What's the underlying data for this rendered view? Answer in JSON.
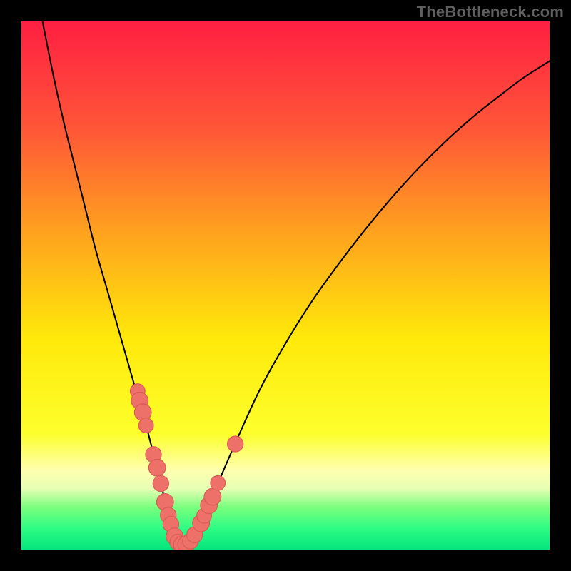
{
  "watermark": "TheBottleneck.com",
  "colors": {
    "frame": "#000000",
    "curve": "#000000",
    "marker_fill": "#ed7069",
    "marker_stroke": "#d85a52",
    "gradient_stops": [
      {
        "offset": 0.0,
        "color": "#ff1f42"
      },
      {
        "offset": 0.2,
        "color": "#ff5538"
      },
      {
        "offset": 0.4,
        "color": "#ffa21e"
      },
      {
        "offset": 0.6,
        "color": "#ffe90a"
      },
      {
        "offset": 0.78,
        "color": "#fdff2c"
      },
      {
        "offset": 0.85,
        "color": "#feffaf"
      },
      {
        "offset": 0.885,
        "color": "#e6ffb4"
      },
      {
        "offset": 0.92,
        "color": "#7aff7d"
      },
      {
        "offset": 0.96,
        "color": "#2dfc84"
      },
      {
        "offset": 1.0,
        "color": "#05e57c"
      }
    ]
  },
  "chart_data": {
    "type": "line",
    "title": "",
    "xlabel": "",
    "ylabel": "",
    "xlim": [
      0,
      100
    ],
    "ylim": [
      0,
      100
    ],
    "grid": false,
    "legend": false,
    "series": [
      {
        "name": "bottleneck-curve",
        "x": [
          4,
          6,
          8,
          10,
          12,
          14,
          16,
          18,
          20,
          22,
          24,
          26,
          27,
          28,
          29,
          30,
          31,
          33,
          35,
          37,
          40,
          45,
          50,
          55,
          60,
          65,
          70,
          75,
          80,
          85,
          90,
          95,
          100
        ],
        "y": [
          100,
          90,
          81,
          73,
          65,
          57,
          50,
          43,
          36,
          29,
          22,
          14,
          10,
          6,
          3,
          1,
          1,
          3,
          7,
          12,
          19,
          30,
          39,
          47,
          54,
          60.5,
          66.5,
          72,
          77,
          81.5,
          85.5,
          89.3,
          92.5
        ]
      }
    ],
    "markers": {
      "name": "data-points",
      "points": [
        {
          "x": 22.0,
          "y": 30.0,
          "r": 1.4
        },
        {
          "x": 22.4,
          "y": 28.2,
          "r": 1.6
        },
        {
          "x": 23.0,
          "y": 26.0,
          "r": 1.6
        },
        {
          "x": 23.6,
          "y": 23.5,
          "r": 1.4
        },
        {
          "x": 25.0,
          "y": 18.0,
          "r": 1.5
        },
        {
          "x": 25.7,
          "y": 15.5,
          "r": 1.6
        },
        {
          "x": 26.4,
          "y": 12.5,
          "r": 1.5
        },
        {
          "x": 27.2,
          "y": 9.0,
          "r": 1.6
        },
        {
          "x": 27.8,
          "y": 6.5,
          "r": 1.5
        },
        {
          "x": 28.3,
          "y": 4.8,
          "r": 1.5
        },
        {
          "x": 29.0,
          "y": 2.5,
          "r": 1.6
        },
        {
          "x": 29.6,
          "y": 1.4,
          "r": 1.5
        },
        {
          "x": 30.4,
          "y": 0.9,
          "r": 1.6
        },
        {
          "x": 31.2,
          "y": 1.0,
          "r": 1.6
        },
        {
          "x": 32.0,
          "y": 1.6,
          "r": 1.5
        },
        {
          "x": 32.8,
          "y": 2.8,
          "r": 1.5
        },
        {
          "x": 34.0,
          "y": 5.0,
          "r": 1.6
        },
        {
          "x": 34.6,
          "y": 6.4,
          "r": 1.4
        },
        {
          "x": 35.5,
          "y": 8.4,
          "r": 1.6
        },
        {
          "x": 36.2,
          "y": 10.0,
          "r": 1.6
        },
        {
          "x": 37.2,
          "y": 12.6,
          "r": 1.4
        },
        {
          "x": 40.5,
          "y": 20.0,
          "r": 1.5
        }
      ]
    }
  }
}
